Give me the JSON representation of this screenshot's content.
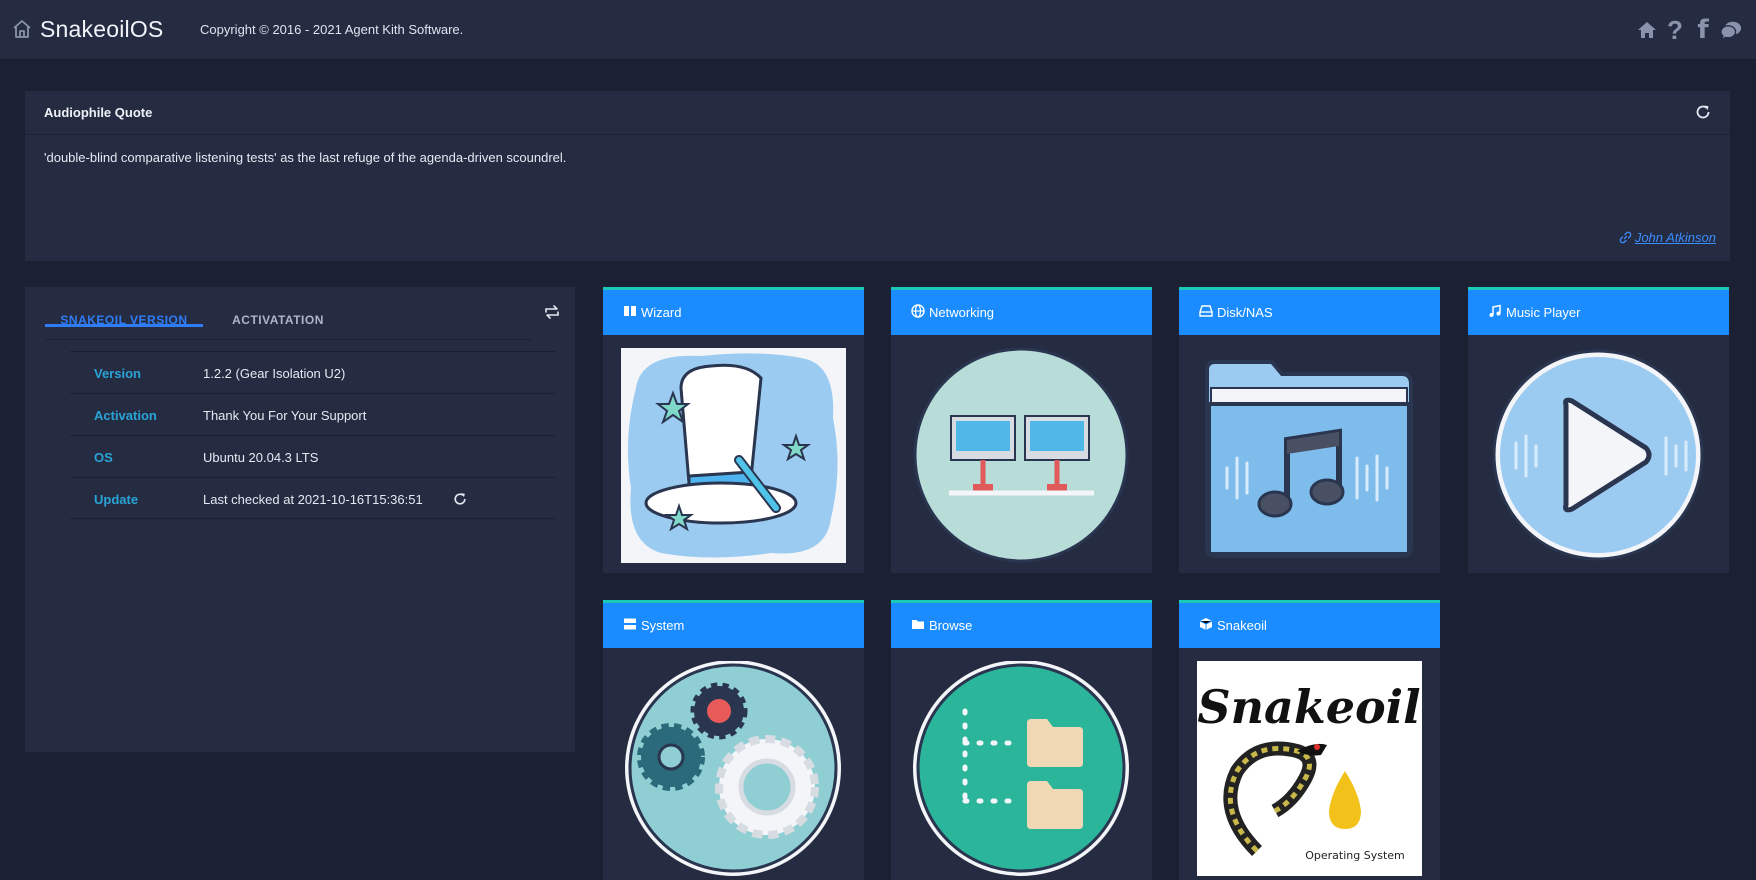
{
  "header": {
    "brand": "SnakeoilOS",
    "copyright": "Copyright © 2016 - 2021 Agent Kith Software.",
    "icons": [
      "home-icon",
      "help-icon",
      "facebook-icon",
      "chat-icon"
    ]
  },
  "quote": {
    "title": "Audiophile Quote",
    "text": "'double-blind comparative listening tests' as the last refuge of the agenda-driven scoundrel.",
    "author": "John Atkinson"
  },
  "version_panel": {
    "tabs": [
      "SNAKEOIL VERSION",
      "ACTIVATATION"
    ],
    "active_tab": "SNAKEOIL VERSION",
    "rows": [
      {
        "key": "Version",
        "value": "1.2.2 (Gear Isolation U2)"
      },
      {
        "key": "Activation",
        "value": "Thank You For Your Support"
      },
      {
        "key": "OS",
        "value": "Ubuntu 20.04.3 LTS"
      },
      {
        "key": "Update",
        "value": "Last checked at 2021-10-16T15:36:51"
      }
    ]
  },
  "tiles": [
    {
      "label": "Wizard",
      "icon": "book-icon"
    },
    {
      "label": "Networking",
      "icon": "globe-icon"
    },
    {
      "label": "Disk/NAS",
      "icon": "hdd-icon"
    },
    {
      "label": "Music Player",
      "icon": "music-note-icon"
    },
    {
      "label": "System",
      "icon": "server-icon"
    },
    {
      "label": "Browse",
      "icon": "folder-icon"
    },
    {
      "label": "Snakeoil",
      "icon": "cube-icon",
      "logo_text": "Snakeoil",
      "logo_subtext": "Operating System"
    }
  ],
  "colors": {
    "background": "#1b2032",
    "card": "#252c42",
    "tile_header": "#1a8cff",
    "accent_teal": "#1bc9b7",
    "link_blue": "#2f7df6",
    "key_cyan": "#2aa4d6"
  }
}
